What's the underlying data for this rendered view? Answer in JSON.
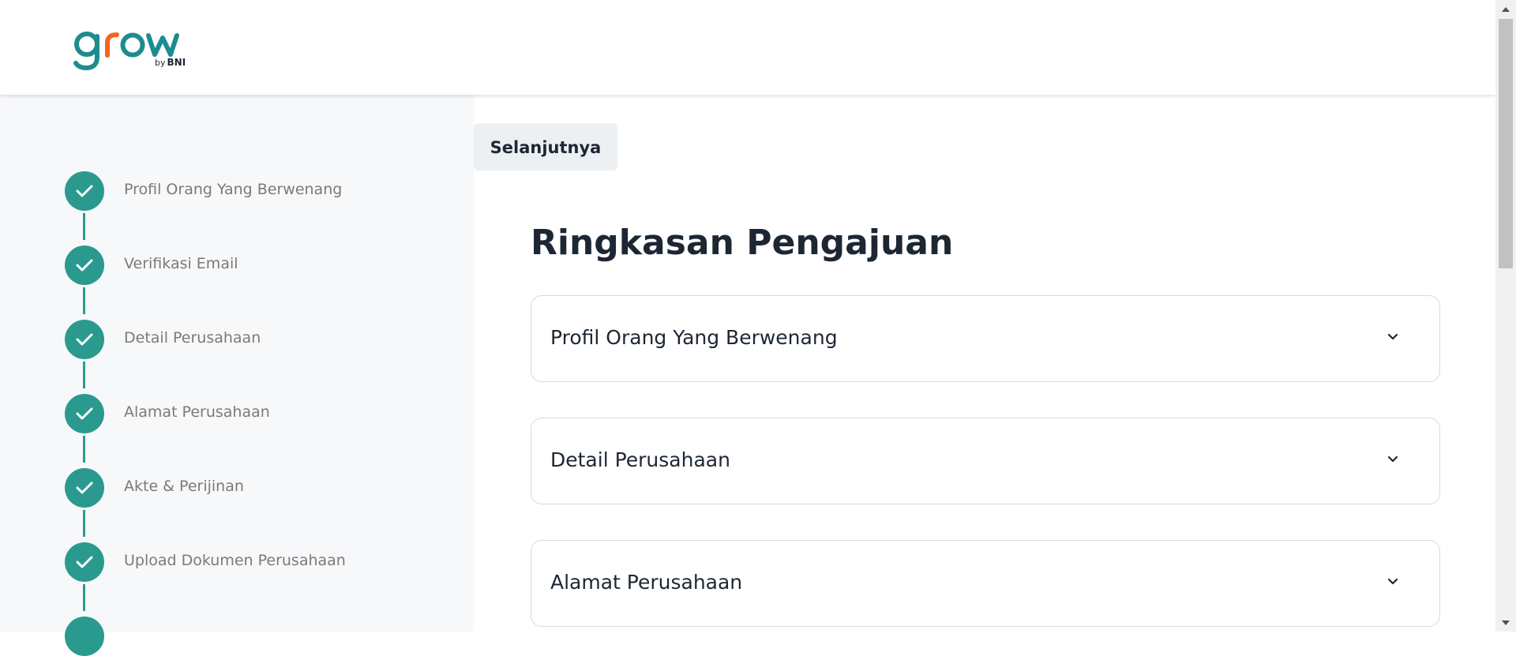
{
  "brand": {
    "logo_text": "grow",
    "sub_by": "by",
    "sub_bank": "BNI",
    "primary_color": "#1d8c8f",
    "accent_color": "#f26522"
  },
  "sidebar": {
    "step_color": "#2a9a8f",
    "steps": [
      {
        "label": "Profil Orang Yang Berwenang",
        "status": "completed",
        "icon": "check-icon"
      },
      {
        "label": "Verifikasi Email",
        "status": "completed",
        "icon": "check-icon"
      },
      {
        "label": "Detail Perusahaan",
        "status": "completed",
        "icon": "check-icon"
      },
      {
        "label": "Alamat Perusahaan",
        "status": "completed",
        "icon": "check-icon"
      },
      {
        "label": "Akte & Perijinan",
        "status": "completed",
        "icon": "check-icon"
      },
      {
        "label": "Upload Dokumen Perusahaan",
        "status": "completed",
        "icon": "check-icon"
      }
    ]
  },
  "main": {
    "next_button_label": "Selanjutnya",
    "title": "Ringkasan Pengajuan",
    "sections": [
      {
        "title": "Profil Orang Yang Berwenang",
        "expanded": false,
        "icon": "chevron-down-icon"
      },
      {
        "title": "Detail Perusahaan",
        "expanded": false,
        "icon": "chevron-down-icon"
      },
      {
        "title": "Alamat Perusahaan",
        "expanded": false,
        "icon": "chevron-down-icon"
      }
    ]
  }
}
